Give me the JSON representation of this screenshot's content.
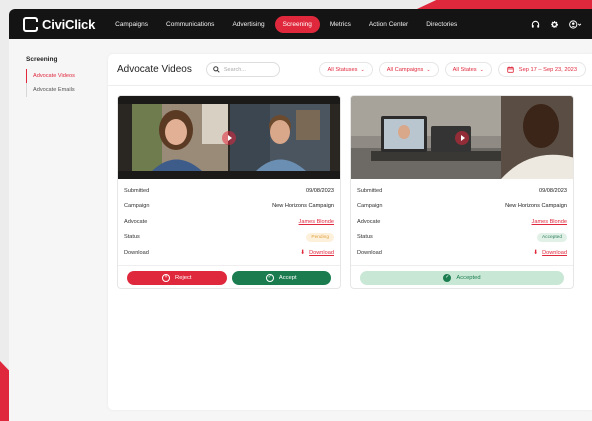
{
  "app": {
    "name": "CiviClick"
  },
  "colors": {
    "accent": "#e0283c",
    "success": "#1b7d4f",
    "pending": "#e0a243",
    "nav_bg": "#141414"
  },
  "nav": {
    "items": [
      "Campaigns",
      "Communications",
      "Advertising",
      "Screening",
      "Metrics",
      "Action Center",
      "Directories"
    ],
    "active": "Screening",
    "icons": [
      "headset-icon",
      "gear-icon",
      "user-icon",
      "chevron-down-icon"
    ]
  },
  "sidebar": {
    "title": "Screening",
    "items": [
      {
        "label": "Advocate Videos",
        "active": true
      },
      {
        "label": "Advocate Emails",
        "active": false
      }
    ]
  },
  "main": {
    "title": "Advocate Videos",
    "search": {
      "placeholder": "Search..."
    },
    "filters": {
      "status": "All Statuses",
      "campaign": "All Campaigns",
      "state": "All States",
      "date_range": "Sep 17 – Sep 23, 2023"
    }
  },
  "field_labels": {
    "submitted": "Submitted",
    "campaign": "Campaign",
    "advocate": "Advocate",
    "status": "Status",
    "download": "Download"
  },
  "cards": [
    {
      "submitted": "09/08/2023",
      "campaign": "New Horizons Campaign",
      "advocate": "James Blonde",
      "status": "Pending",
      "download": "Download",
      "actions": {
        "reject": "Reject",
        "accept": "Accept"
      }
    },
    {
      "submitted": "09/08/2023",
      "campaign": "New Horizons Campaign",
      "advocate": "James Blonde",
      "status": "Accepted",
      "download": "Download",
      "actions": {
        "accepted": "Accepted"
      }
    }
  ]
}
